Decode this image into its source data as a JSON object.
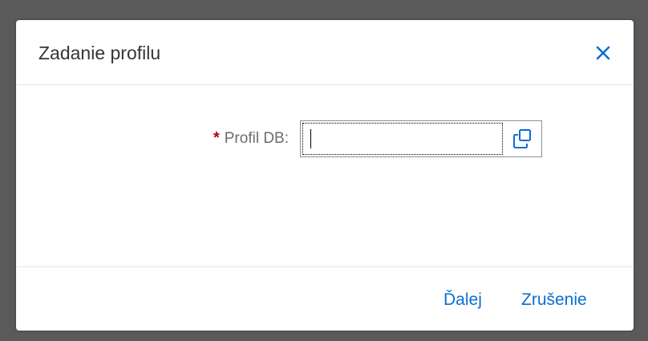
{
  "dialog": {
    "title": "Zadanie profilu"
  },
  "form": {
    "required_marker": "*",
    "field_label": "Profil DB:",
    "field_value": "",
    "field_placeholder": ""
  },
  "footer": {
    "next_label": "Ďalej",
    "cancel_label": "Zrušenie"
  },
  "icons": {
    "close": "close-icon",
    "value_help": "value-help-icon"
  },
  "colors": {
    "accent": "#0a6ed1",
    "required": "#bb0000",
    "label": "#6a6d70",
    "title": "#32363a",
    "backdrop": "#5a5a5a"
  }
}
